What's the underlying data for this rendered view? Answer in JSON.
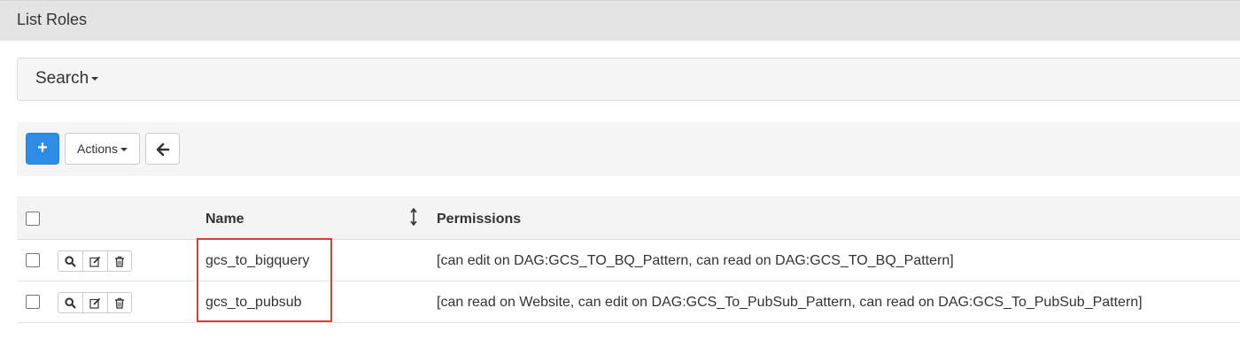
{
  "header": {
    "title": "List Roles"
  },
  "search": {
    "label": "Search"
  },
  "toolbar": {
    "add_label": "+",
    "actions_label": "Actions",
    "back_icon": "arrow-left-icon"
  },
  "table": {
    "columns": [
      "Name",
      "Permissions"
    ],
    "row_icons": [
      "search-icon",
      "edit-icon",
      "trash-icon"
    ],
    "rows": [
      {
        "name": "gcs_to_bigquery",
        "permissions": "[can edit on DAG:GCS_TO_BQ_Pattern, can read on DAG:GCS_TO_BQ_Pattern]"
      },
      {
        "name": "gcs_to_pubsub",
        "permissions": "[can read on Website, can edit on DAG:GCS_To_PubSub_Pattern, can read on DAG:GCS_To_PubSub_Pattern]"
      }
    ]
  },
  "colors": {
    "primary": "#2f8ce6",
    "highlight": "#e03a3a"
  }
}
